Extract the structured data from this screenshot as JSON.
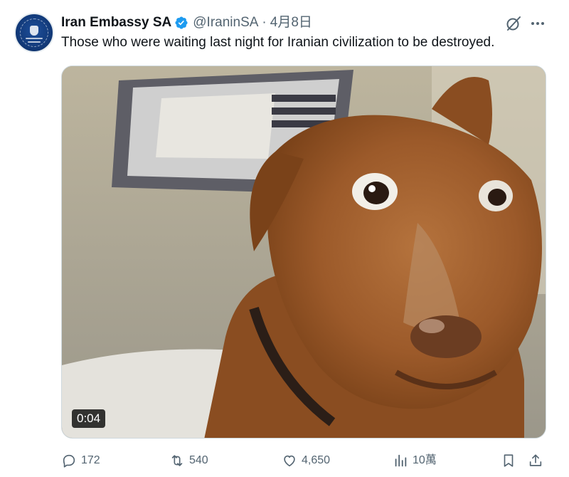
{
  "author": {
    "display_name": "Iran Embassy SA",
    "handle": "@IraninSA",
    "separator": "·",
    "date": "4月8日",
    "verified": true
  },
  "tweet": {
    "text": "Those who were waiting last night for Iranian civilization to be destroyed."
  },
  "media": {
    "type": "video",
    "description_icon": "video-thumbnail",
    "timestamp": "0:04"
  },
  "actions": {
    "replies": "172",
    "reposts": "540",
    "likes": "4,650",
    "views": "10萬"
  },
  "icons": {
    "verified": "verified-badge-icon",
    "grok": "grok-icon",
    "more": "more-icon",
    "reply": "reply-icon",
    "repost": "repost-icon",
    "like": "heart-icon",
    "views": "views-icon",
    "bookmark": "bookmark-icon",
    "share": "share-icon"
  },
  "colors": {
    "verified": "#1d9bf0",
    "secondary_text": "#536471",
    "primary_text": "#0f1419"
  }
}
